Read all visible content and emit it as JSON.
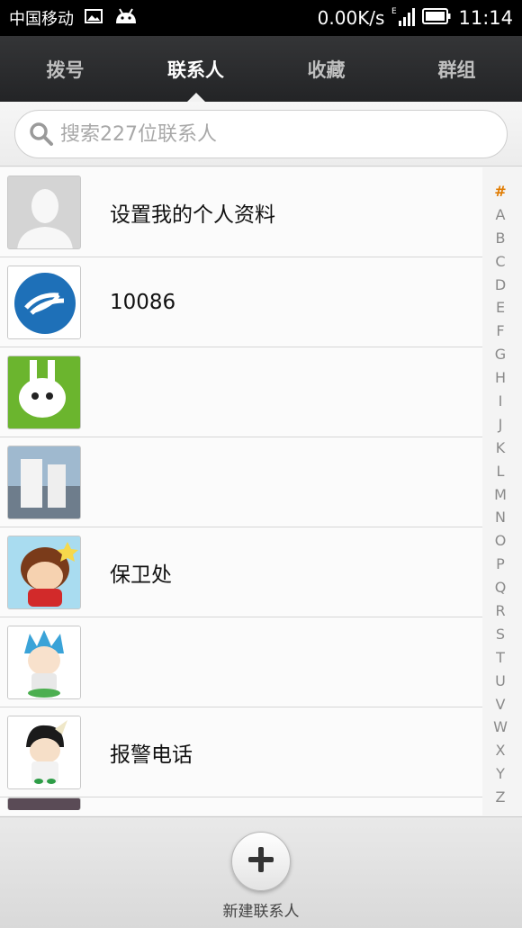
{
  "status_bar": {
    "carrier": "中国移动",
    "speed": "0.00K/s",
    "time": "11:14"
  },
  "tabs": [
    {
      "label": "拨号",
      "active": false
    },
    {
      "label": "联系人",
      "active": true
    },
    {
      "label": "收藏",
      "active": false
    },
    {
      "label": "群组",
      "active": false
    }
  ],
  "search": {
    "placeholder": "搜索227位联系人"
  },
  "contacts": [
    {
      "name": "设置我的个人资料",
      "avatar": "default-person-avatar"
    },
    {
      "name": "10086",
      "avatar": "china-mobile-logo-avatar"
    },
    {
      "name": "",
      "avatar": "green-cartoon-avatar"
    },
    {
      "name": "",
      "avatar": "photo-avatar"
    },
    {
      "name": "保卫处",
      "avatar": "cartoon-boy-avatar"
    },
    {
      "name": "",
      "avatar": "anime-blue-hair-avatar"
    },
    {
      "name": "报警电话",
      "avatar": "anime-character-avatar"
    }
  ],
  "alphabet_index": [
    "#",
    "A",
    "B",
    "C",
    "D",
    "E",
    "F",
    "G",
    "H",
    "I",
    "J",
    "K",
    "L",
    "M",
    "N",
    "O",
    "P",
    "Q",
    "R",
    "S",
    "T",
    "U",
    "V",
    "W",
    "X",
    "Y",
    "Z"
  ],
  "bottom": {
    "new_contact_label": "新建联系人"
  },
  "colors": {
    "accent": "#e07b00",
    "tabbar": "#2b2c2e"
  }
}
